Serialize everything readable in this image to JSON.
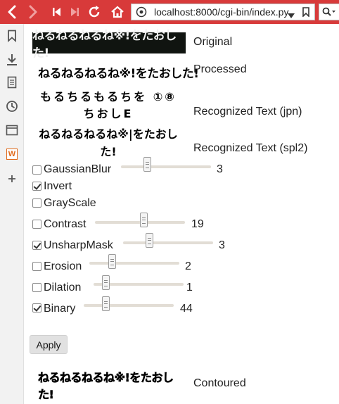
{
  "browser": {
    "url": "localhost:8000/cgi-bin/index.py",
    "icons": [
      "back-icon",
      "forward-icon",
      "first-page-icon",
      "last-page-icon",
      "reload-icon",
      "home-icon",
      "site-info-icon",
      "dropdown-icon",
      "bookmark-icon",
      "search-icon"
    ],
    "toolbar_color": "#d83a3a"
  },
  "sidebar": {
    "icons": [
      "bookmarks-icon",
      "downloads-icon",
      "reading-list-icon",
      "history-icon",
      "window-icon",
      "addon-w-icon",
      "add-icon"
    ],
    "addon_letter": "W"
  },
  "images": {
    "original_text": "ねるねるねるね※!をたおした!",
    "processed_text": "ねるねるねるね※!をたおした!",
    "contoured_text": "ねるねるねるね※!をたおした!"
  },
  "labels": {
    "original": "Original",
    "processed": "Processed",
    "recognized_jpn": "Recognized Text (jpn)",
    "recognized_spl2": "Recognized Text (spl2)",
    "contoured": "Contoured"
  },
  "recognized": {
    "jpn_line1": "もるちるもるちを ①⑧",
    "jpn_line2": "ちおしE",
    "spl2_line1": "ねるねるねるね※|をたおし",
    "spl2_line2": "た!"
  },
  "options": [
    {
      "label": "GaussianBlur",
      "checked": false,
      "value": "3",
      "level": 0.27
    },
    {
      "label": "Invert",
      "checked": true
    },
    {
      "label": "GrayScale",
      "checked": false
    },
    {
      "label": "Contrast",
      "checked": false,
      "value": "19",
      "level": 0.55
    },
    {
      "label": "UnsharpMask",
      "checked": true,
      "value": "3",
      "level": 0.27
    },
    {
      "label": "Erosion",
      "checked": false,
      "value": "2",
      "level": 0.23
    },
    {
      "label": "Dilation",
      "checked": false,
      "value": "1",
      "level": 0.1
    },
    {
      "label": "Binary",
      "checked": true,
      "value": "44",
      "level": 0.22
    }
  ],
  "apply_label": "Apply"
}
